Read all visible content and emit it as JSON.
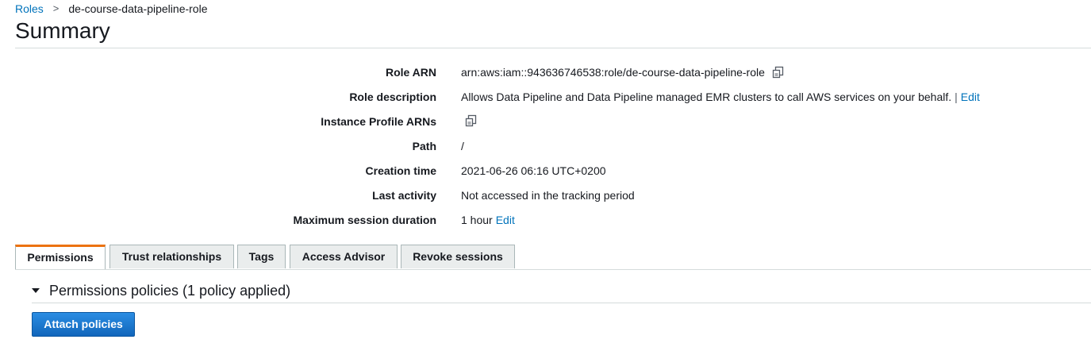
{
  "breadcrumb": {
    "parent": "Roles",
    "separator": ">",
    "current": "de-course-data-pipeline-role"
  },
  "page_title": "Summary",
  "summary": {
    "role_arn": {
      "label": "Role ARN",
      "value": "arn:aws:iam::943636746538:role/de-course-data-pipeline-role",
      "icon": "copy-icon"
    },
    "role_description": {
      "label": "Role description",
      "value": "Allows Data Pipeline and Data Pipeline managed EMR clusters to call AWS services on your behalf.",
      "separator": "|",
      "edit": "Edit"
    },
    "instance_profile_arns": {
      "label": "Instance Profile ARNs",
      "icon": "copy-icon"
    },
    "path": {
      "label": "Path",
      "value": "/"
    },
    "creation_time": {
      "label": "Creation time",
      "value": "2021-06-26 06:16 UTC+0200"
    },
    "last_activity": {
      "label": "Last activity",
      "value": "Not accessed in the tracking period"
    },
    "max_session_duration": {
      "label": "Maximum session duration",
      "value": "1 hour",
      "edit": "Edit"
    }
  },
  "tabs": [
    {
      "label": "Permissions",
      "active": true
    },
    {
      "label": "Trust relationships",
      "active": false
    },
    {
      "label": "Tags",
      "active": false
    },
    {
      "label": "Access Advisor",
      "active": false
    },
    {
      "label": "Revoke sessions",
      "active": false
    }
  ],
  "permissions": {
    "section_title": "Permissions policies (1 policy applied)",
    "attach_button": "Attach policies"
  },
  "colors": {
    "link": "#0073bb",
    "active_tab_accent": "#ec7211",
    "primary_button": "#1166bb"
  }
}
